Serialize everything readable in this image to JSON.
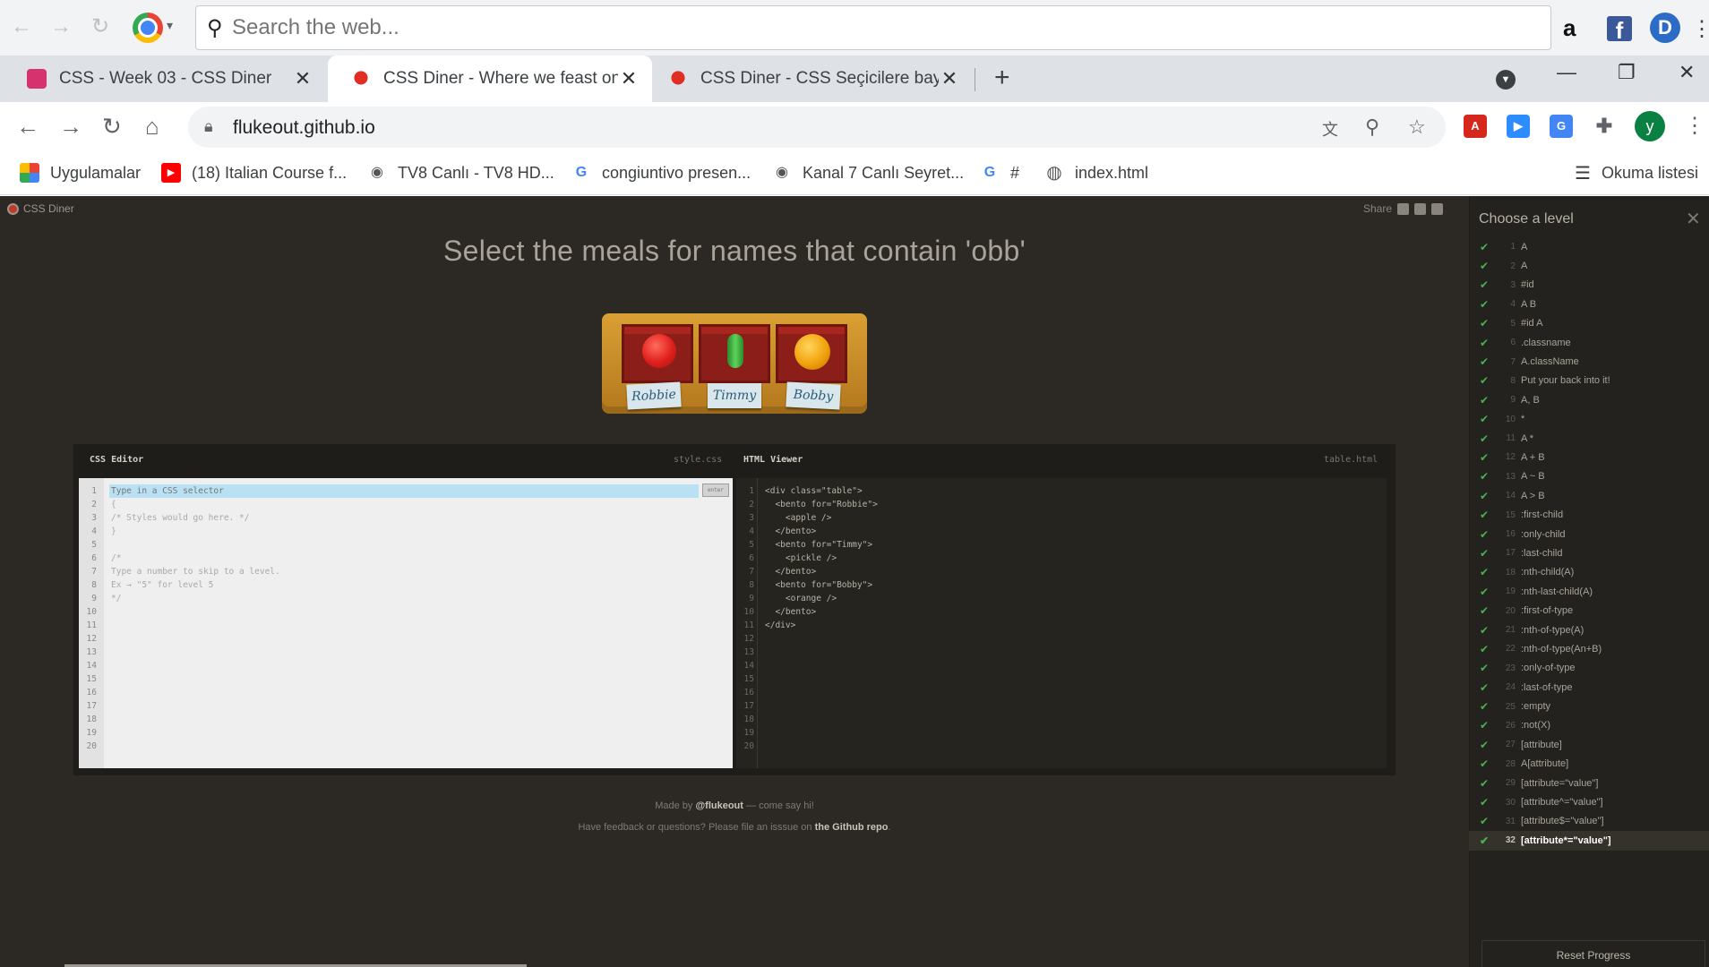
{
  "topbar": {
    "search_placeholder": "Search the web...",
    "amazon_icon": "a",
    "fb_icon": "f",
    "d_icon": "D"
  },
  "tabs": [
    {
      "title": "CSS - Week 03 - CSS Diner",
      "active": false
    },
    {
      "title": "CSS Diner - Where we feast on CSS Selectors!",
      "active": true
    },
    {
      "title": "CSS Diner - CSS Seçicilere bayıldık",
      "active": false
    }
  ],
  "address": {
    "url": "flukeout.github.io"
  },
  "bookmarks": [
    {
      "label": "Uygulamalar",
      "icon": "apps-grid-icon"
    },
    {
      "label": "(18) Italian Course f...",
      "icon": "youtube-icon"
    },
    {
      "label": "TV8 Canlı - TV8 HD...",
      "icon": "eye-icon"
    },
    {
      "label": "congiuntivo presen...",
      "icon": "google-icon"
    },
    {
      "label": "Kanal 7 Canlı Seyret...",
      "icon": "eye-icon"
    },
    {
      "label": "#",
      "icon": "google-icon"
    },
    {
      "label": "index.html",
      "icon": "globe-icon"
    }
  ],
  "reading_list": "Okuma listesi",
  "site": {
    "brand": "CSS Diner",
    "share": "Share",
    "headline": "Select the meals for names that contain 'obb'",
    "names": [
      "Robbie",
      "Timmy",
      "Bobby"
    ]
  },
  "editor": {
    "css_title": "CSS Editor",
    "css_file": "style.css",
    "html_title": "HTML Viewer",
    "html_file": "table.html",
    "input_placeholder": "Type in a CSS selector",
    "enter_label": "enter",
    "css_lines": [
      "",
      "{",
      "/* Styles would go here. */",
      "}",
      "",
      "/*",
      "Type a number to skip to a level.",
      "Ex → \"5\" for level 5",
      "*/"
    ],
    "html_lines": [
      "<div class=\"table\">",
      "  <bento for=\"Robbie\">",
      "    <apple />",
      "  </bento>",
      "  <bento for=\"Timmy\">",
      "    <pickle />",
      "  </bento>",
      "  <bento for=\"Bobby\">",
      "    <orange />",
      "  </bento>",
      "</div>"
    ],
    "line_count": 20
  },
  "footer": {
    "line1_pre": "Made by ",
    "line1_link": "@flukeout",
    "line1_post": " — come say hi!",
    "line2_pre": "Have feedback or questions? Please file an isssue on ",
    "line2_link": "the Github repo",
    "line2_post": "."
  },
  "levels": {
    "title": "Choose a level",
    "items": [
      {
        "n": "1",
        "label": "A"
      },
      {
        "n": "2",
        "label": "A"
      },
      {
        "n": "3",
        "label": "#id"
      },
      {
        "n": "4",
        "label": "A B"
      },
      {
        "n": "5",
        "label": "#id A"
      },
      {
        "n": "6",
        "label": ".classname"
      },
      {
        "n": "7",
        "label": "A.className"
      },
      {
        "n": "8",
        "label": "Put your back into it!"
      },
      {
        "n": "9",
        "label": "A, B"
      },
      {
        "n": "10",
        "label": "*"
      },
      {
        "n": "11",
        "label": "A *"
      },
      {
        "n": "12",
        "label": "A + B"
      },
      {
        "n": "13",
        "label": "A ~ B"
      },
      {
        "n": "14",
        "label": "A > B"
      },
      {
        "n": "15",
        "label": ":first-child"
      },
      {
        "n": "16",
        "label": ":only-child"
      },
      {
        "n": "17",
        "label": ":last-child"
      },
      {
        "n": "18",
        "label": ":nth-child(A)"
      },
      {
        "n": "19",
        "label": ":nth-last-child(A)"
      },
      {
        "n": "20",
        "label": ":first-of-type"
      },
      {
        "n": "21",
        "label": ":nth-of-type(A)"
      },
      {
        "n": "22",
        "label": ":nth-of-type(An+B)"
      },
      {
        "n": "23",
        "label": ":only-of-type"
      },
      {
        "n": "24",
        "label": ":last-of-type"
      },
      {
        "n": "25",
        "label": ":empty"
      },
      {
        "n": "26",
        "label": ":not(X)"
      },
      {
        "n": "27",
        "label": "[attribute]"
      },
      {
        "n": "28",
        "label": "A[attribute]"
      },
      {
        "n": "29",
        "label": "[attribute=\"value\"]"
      },
      {
        "n": "30",
        "label": "[attribute^=\"value\"]"
      },
      {
        "n": "31",
        "label": "[attribute$=\"value\"]"
      },
      {
        "n": "32",
        "label": "[attribute*=\"value\"]"
      }
    ],
    "current": "32",
    "reset": "Reset Progress"
  },
  "colors": {
    "page_bg": "#2c2925",
    "check": "#4caf50",
    "table": "#c98c2a",
    "bento": "#8b1e18",
    "apple": "#e0201c",
    "pickle": "#3aa83a",
    "orange": "#f2a20c"
  }
}
